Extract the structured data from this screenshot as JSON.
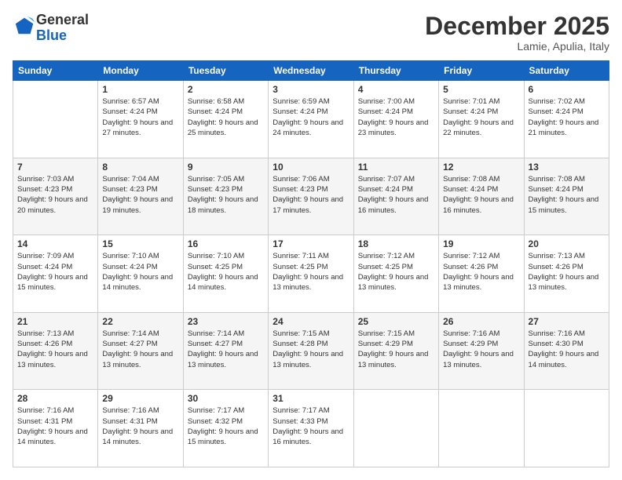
{
  "logo": {
    "general": "General",
    "blue": "Blue"
  },
  "header": {
    "month": "December 2025",
    "location": "Lamie, Apulia, Italy"
  },
  "weekdays": [
    "Sunday",
    "Monday",
    "Tuesday",
    "Wednesday",
    "Thursday",
    "Friday",
    "Saturday"
  ],
  "weeks": [
    [
      {
        "day": "",
        "sunrise": "",
        "sunset": "",
        "daylight": ""
      },
      {
        "day": "1",
        "sunrise": "Sunrise: 6:57 AM",
        "sunset": "Sunset: 4:24 PM",
        "daylight": "Daylight: 9 hours and 27 minutes."
      },
      {
        "day": "2",
        "sunrise": "Sunrise: 6:58 AM",
        "sunset": "Sunset: 4:24 PM",
        "daylight": "Daylight: 9 hours and 25 minutes."
      },
      {
        "day": "3",
        "sunrise": "Sunrise: 6:59 AM",
        "sunset": "Sunset: 4:24 PM",
        "daylight": "Daylight: 9 hours and 24 minutes."
      },
      {
        "day": "4",
        "sunrise": "Sunrise: 7:00 AM",
        "sunset": "Sunset: 4:24 PM",
        "daylight": "Daylight: 9 hours and 23 minutes."
      },
      {
        "day": "5",
        "sunrise": "Sunrise: 7:01 AM",
        "sunset": "Sunset: 4:24 PM",
        "daylight": "Daylight: 9 hours and 22 minutes."
      },
      {
        "day": "6",
        "sunrise": "Sunrise: 7:02 AM",
        "sunset": "Sunset: 4:24 PM",
        "daylight": "Daylight: 9 hours and 21 minutes."
      }
    ],
    [
      {
        "day": "7",
        "sunrise": "Sunrise: 7:03 AM",
        "sunset": "Sunset: 4:23 PM",
        "daylight": "Daylight: 9 hours and 20 minutes."
      },
      {
        "day": "8",
        "sunrise": "Sunrise: 7:04 AM",
        "sunset": "Sunset: 4:23 PM",
        "daylight": "Daylight: 9 hours and 19 minutes."
      },
      {
        "day": "9",
        "sunrise": "Sunrise: 7:05 AM",
        "sunset": "Sunset: 4:23 PM",
        "daylight": "Daylight: 9 hours and 18 minutes."
      },
      {
        "day": "10",
        "sunrise": "Sunrise: 7:06 AM",
        "sunset": "Sunset: 4:23 PM",
        "daylight": "Daylight: 9 hours and 17 minutes."
      },
      {
        "day": "11",
        "sunrise": "Sunrise: 7:07 AM",
        "sunset": "Sunset: 4:24 PM",
        "daylight": "Daylight: 9 hours and 16 minutes."
      },
      {
        "day": "12",
        "sunrise": "Sunrise: 7:08 AM",
        "sunset": "Sunset: 4:24 PM",
        "daylight": "Daylight: 9 hours and 16 minutes."
      },
      {
        "day": "13",
        "sunrise": "Sunrise: 7:08 AM",
        "sunset": "Sunset: 4:24 PM",
        "daylight": "Daylight: 9 hours and 15 minutes."
      }
    ],
    [
      {
        "day": "14",
        "sunrise": "Sunrise: 7:09 AM",
        "sunset": "Sunset: 4:24 PM",
        "daylight": "Daylight: 9 hours and 15 minutes."
      },
      {
        "day": "15",
        "sunrise": "Sunrise: 7:10 AM",
        "sunset": "Sunset: 4:24 PM",
        "daylight": "Daylight: 9 hours and 14 minutes."
      },
      {
        "day": "16",
        "sunrise": "Sunrise: 7:10 AM",
        "sunset": "Sunset: 4:25 PM",
        "daylight": "Daylight: 9 hours and 14 minutes."
      },
      {
        "day": "17",
        "sunrise": "Sunrise: 7:11 AM",
        "sunset": "Sunset: 4:25 PM",
        "daylight": "Daylight: 9 hours and 13 minutes."
      },
      {
        "day": "18",
        "sunrise": "Sunrise: 7:12 AM",
        "sunset": "Sunset: 4:25 PM",
        "daylight": "Daylight: 9 hours and 13 minutes."
      },
      {
        "day": "19",
        "sunrise": "Sunrise: 7:12 AM",
        "sunset": "Sunset: 4:26 PM",
        "daylight": "Daylight: 9 hours and 13 minutes."
      },
      {
        "day": "20",
        "sunrise": "Sunrise: 7:13 AM",
        "sunset": "Sunset: 4:26 PM",
        "daylight": "Daylight: 9 hours and 13 minutes."
      }
    ],
    [
      {
        "day": "21",
        "sunrise": "Sunrise: 7:13 AM",
        "sunset": "Sunset: 4:26 PM",
        "daylight": "Daylight: 9 hours and 13 minutes."
      },
      {
        "day": "22",
        "sunrise": "Sunrise: 7:14 AM",
        "sunset": "Sunset: 4:27 PM",
        "daylight": "Daylight: 9 hours and 13 minutes."
      },
      {
        "day": "23",
        "sunrise": "Sunrise: 7:14 AM",
        "sunset": "Sunset: 4:27 PM",
        "daylight": "Daylight: 9 hours and 13 minutes."
      },
      {
        "day": "24",
        "sunrise": "Sunrise: 7:15 AM",
        "sunset": "Sunset: 4:28 PM",
        "daylight": "Daylight: 9 hours and 13 minutes."
      },
      {
        "day": "25",
        "sunrise": "Sunrise: 7:15 AM",
        "sunset": "Sunset: 4:29 PM",
        "daylight": "Daylight: 9 hours and 13 minutes."
      },
      {
        "day": "26",
        "sunrise": "Sunrise: 7:16 AM",
        "sunset": "Sunset: 4:29 PM",
        "daylight": "Daylight: 9 hours and 13 minutes."
      },
      {
        "day": "27",
        "sunrise": "Sunrise: 7:16 AM",
        "sunset": "Sunset: 4:30 PM",
        "daylight": "Daylight: 9 hours and 14 minutes."
      }
    ],
    [
      {
        "day": "28",
        "sunrise": "Sunrise: 7:16 AM",
        "sunset": "Sunset: 4:31 PM",
        "daylight": "Daylight: 9 hours and 14 minutes."
      },
      {
        "day": "29",
        "sunrise": "Sunrise: 7:16 AM",
        "sunset": "Sunset: 4:31 PM",
        "daylight": "Daylight: 9 hours and 14 minutes."
      },
      {
        "day": "30",
        "sunrise": "Sunrise: 7:17 AM",
        "sunset": "Sunset: 4:32 PM",
        "daylight": "Daylight: 9 hours and 15 minutes."
      },
      {
        "day": "31",
        "sunrise": "Sunrise: 7:17 AM",
        "sunset": "Sunset: 4:33 PM",
        "daylight": "Daylight: 9 hours and 16 minutes."
      },
      {
        "day": "",
        "sunrise": "",
        "sunset": "",
        "daylight": ""
      },
      {
        "day": "",
        "sunrise": "",
        "sunset": "",
        "daylight": ""
      },
      {
        "day": "",
        "sunrise": "",
        "sunset": "",
        "daylight": ""
      }
    ]
  ]
}
